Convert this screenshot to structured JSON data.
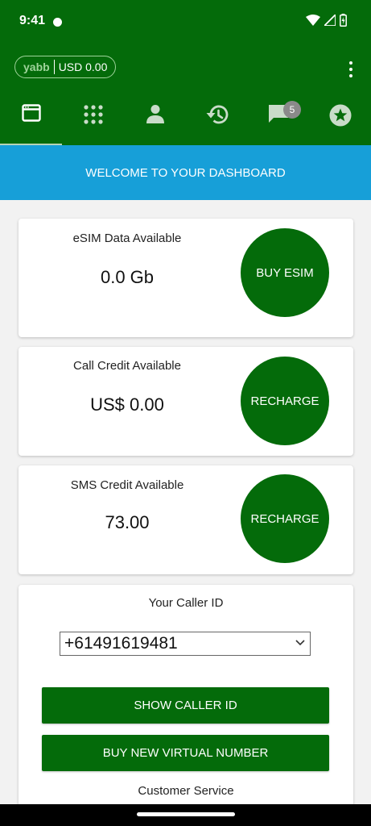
{
  "status_bar": {
    "time": "9:41"
  },
  "account": {
    "brand": "yabb",
    "balance": "USD 0.00"
  },
  "tabs": [
    {
      "icon": "browser-window-icon",
      "active": true
    },
    {
      "icon": "dialpad-icon",
      "active": false
    },
    {
      "icon": "contact-person-icon",
      "active": false
    },
    {
      "icon": "history-icon",
      "active": false
    },
    {
      "icon": "chat-icon",
      "active": false,
      "badge": "5"
    },
    {
      "icon": "star-icon",
      "active": false
    }
  ],
  "welcome": "WELCOME TO YOUR DASHBOARD",
  "cards": {
    "esim": {
      "label": "eSIM Data Available",
      "value": "0.0 Gb",
      "button": "BUY ESIM"
    },
    "call": {
      "label": "Call Credit Available",
      "value": "US$ 0.00",
      "button": "RECHARGE"
    },
    "sms": {
      "label": "SMS Credit Available",
      "value": "73.00",
      "button": "RECHARGE"
    }
  },
  "caller_id": {
    "title": "Your Caller ID",
    "selected": "+61491619481",
    "show_button": "SHOW CALLER ID",
    "buy_button": "BUY NEW VIRTUAL NUMBER",
    "customer_service": "Customer Service"
  },
  "colors": {
    "header": "#046b0a",
    "welcome_banner": "#179fd8",
    "button": "#046b0a",
    "background": "#f2f2f2"
  }
}
